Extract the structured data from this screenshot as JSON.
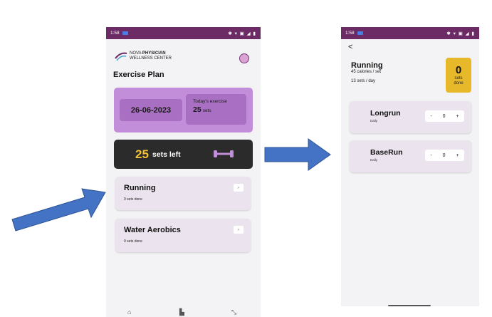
{
  "left_screen": {
    "status": {
      "time": "1:58",
      "icons": "✱ ▾ ▣ ◢ ▮"
    },
    "logo": {
      "line1_pre": "NOVA ",
      "line1_bold": "PHYSICIAN",
      "line2": "WELLNESS CENTER"
    },
    "page_title": "Exercise Plan",
    "date": "26-06-2023",
    "today_label": "Today's exercise",
    "today_value": "25",
    "today_unit": "sets",
    "sets_left_num": "25",
    "sets_left_text": "sets left",
    "exercises": [
      {
        "name": "Running",
        "status": "0 sets done",
        "button": ">"
      },
      {
        "name": "Water Aerobics",
        "status": "0 sets done",
        "button": ">"
      }
    ],
    "nav_icons": [
      "home-icon",
      "chart-icon",
      "expand-icon"
    ]
  },
  "right_screen": {
    "status": {
      "time": "1:58",
      "icons": "✱ ▾ ▣ ◢ ▮"
    },
    "back": "<",
    "title": "Running",
    "calories": "45 calories / set",
    "sets_per_day": "13 sets / day",
    "done_num": "0",
    "done_label_1": "sets",
    "done_label_2": "done",
    "items": [
      {
        "name": "Longrun",
        "freq": "Daily",
        "minus": "-",
        "count": "0",
        "plus": "+"
      },
      {
        "name": "BaseRun",
        "freq": "Daily",
        "minus": "-",
        "count": "0",
        "plus": "+"
      }
    ]
  },
  "colors": {
    "arrow": "#4472c4",
    "status_bar": "#6d2b66",
    "purple_card": "#c38ed9",
    "dark_card": "#2b2b2b",
    "accent_yellow": "#e7b92a"
  }
}
